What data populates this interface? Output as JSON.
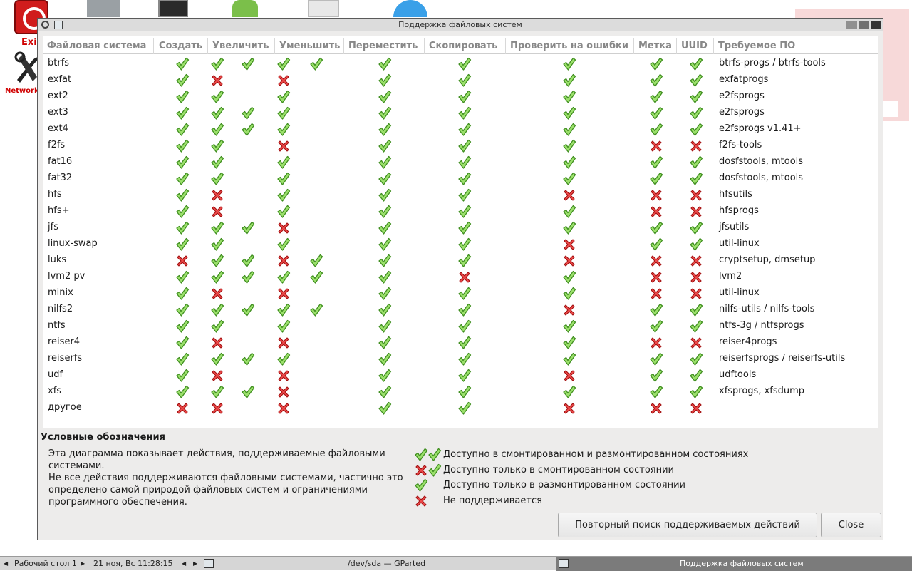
{
  "desktop": {
    "exit_label": "Exi",
    "network_label": "Network"
  },
  "window": {
    "title": "Поддержка файловых систем"
  },
  "table": {
    "headers": [
      "Файловая система",
      "Создать",
      "Увеличить",
      "Уменьшить",
      "Переместить",
      "Скопировать",
      "Проверить на ошибки",
      "Метка",
      "UUID",
      "Требуемое ПО"
    ],
    "rows": [
      {
        "fs": "btrfs",
        "software": "btrfs-progs / btrfs-tools",
        "create": "y",
        "grow": "yy",
        "shrink": "yy",
        "move": "y",
        "copy": "y",
        "check": "y",
        "label": "y",
        "uuid": "y"
      },
      {
        "fs": "exfat",
        "software": "exfatprogs",
        "create": "y",
        "grow": "n",
        "shrink": "n",
        "move": "y",
        "copy": "y",
        "check": "y",
        "label": "y",
        "uuid": "y"
      },
      {
        "fs": "ext2",
        "software": "e2fsprogs",
        "create": "y",
        "grow": "y",
        "shrink": "y",
        "move": "y",
        "copy": "y",
        "check": "y",
        "label": "y",
        "uuid": "y"
      },
      {
        "fs": "ext3",
        "software": "e2fsprogs",
        "create": "y",
        "grow": "yy",
        "shrink": "y",
        "move": "y",
        "copy": "y",
        "check": "y",
        "label": "y",
        "uuid": "y"
      },
      {
        "fs": "ext4",
        "software": "e2fsprogs v1.41+",
        "create": "y",
        "grow": "yy",
        "shrink": "y",
        "move": "y",
        "copy": "y",
        "check": "y",
        "label": "y",
        "uuid": "y"
      },
      {
        "fs": "f2fs",
        "software": "f2fs-tools",
        "create": "y",
        "grow": "y",
        "shrink": "n",
        "move": "y",
        "copy": "y",
        "check": "y",
        "label": "n",
        "uuid": "n"
      },
      {
        "fs": "fat16",
        "software": "dosfstools, mtools",
        "create": "y",
        "grow": "y",
        "shrink": "y",
        "move": "y",
        "copy": "y",
        "check": "y",
        "label": "y",
        "uuid": "y"
      },
      {
        "fs": "fat32",
        "software": "dosfstools, mtools",
        "create": "y",
        "grow": "y",
        "shrink": "y",
        "move": "y",
        "copy": "y",
        "check": "y",
        "label": "y",
        "uuid": "y"
      },
      {
        "fs": "hfs",
        "software": "hfsutils",
        "create": "y",
        "grow": "n",
        "shrink": "y",
        "move": "y",
        "copy": "y",
        "check": "n",
        "label": "n",
        "uuid": "n"
      },
      {
        "fs": "hfs+",
        "software": "hfsprogs",
        "create": "y",
        "grow": "n",
        "shrink": "y",
        "move": "y",
        "copy": "y",
        "check": "y",
        "label": "n",
        "uuid": "n"
      },
      {
        "fs": "jfs",
        "software": "jfsutils",
        "create": "y",
        "grow": "yy",
        "shrink": "n",
        "move": "y",
        "copy": "y",
        "check": "y",
        "label": "y",
        "uuid": "y"
      },
      {
        "fs": "linux-swap",
        "software": "util-linux",
        "create": "y",
        "grow": "y",
        "shrink": "y",
        "move": "y",
        "copy": "y",
        "check": "n",
        "label": "y",
        "uuid": "y"
      },
      {
        "fs": "luks",
        "software": "cryptsetup, dmsetup",
        "create": "n",
        "grow": "yy",
        "shrink": "ny",
        "move": "y",
        "copy": "y",
        "check": "n",
        "label": "n",
        "uuid": "n"
      },
      {
        "fs": "lvm2 pv",
        "software": "lvm2",
        "create": "y",
        "grow": "yy",
        "shrink": "yy",
        "move": "y",
        "copy": "n",
        "check": "y",
        "label": "n",
        "uuid": "n"
      },
      {
        "fs": "minix",
        "software": "util-linux",
        "create": "y",
        "grow": "n",
        "shrink": "n",
        "move": "y",
        "copy": "y",
        "check": "y",
        "label": "n",
        "uuid": "n"
      },
      {
        "fs": "nilfs2",
        "software": "nilfs-utils / nilfs-tools",
        "create": "y",
        "grow": "yy",
        "shrink": "yy",
        "move": "y",
        "copy": "y",
        "check": "n",
        "label": "y",
        "uuid": "y"
      },
      {
        "fs": "ntfs",
        "software": "ntfs-3g / ntfsprogs",
        "create": "y",
        "grow": "y",
        "shrink": "y",
        "move": "y",
        "copy": "y",
        "check": "y",
        "label": "y",
        "uuid": "y"
      },
      {
        "fs": "reiser4",
        "software": "reiser4progs",
        "create": "y",
        "grow": "n",
        "shrink": "n",
        "move": "y",
        "copy": "y",
        "check": "y",
        "label": "n",
        "uuid": "n"
      },
      {
        "fs": "reiserfs",
        "software": "reiserfsprogs / reiserfs-utils",
        "create": "y",
        "grow": "yy",
        "shrink": "y",
        "move": "y",
        "copy": "y",
        "check": "y",
        "label": "y",
        "uuid": "y"
      },
      {
        "fs": "udf",
        "software": "udftools",
        "create": "y",
        "grow": "n",
        "shrink": "n",
        "move": "y",
        "copy": "y",
        "check": "n",
        "label": "y",
        "uuid": "y"
      },
      {
        "fs": "xfs",
        "software": "xfsprogs, xfsdump",
        "create": "y",
        "grow": "yy",
        "shrink": "n",
        "move": "y",
        "copy": "y",
        "check": "y",
        "label": "y",
        "uuid": "y"
      },
      {
        "fs": "другое",
        "software": "",
        "create": "n",
        "grow": "n",
        "shrink": "n",
        "move": "y",
        "copy": "y",
        "check": "n",
        "label": "n",
        "uuid": "n"
      }
    ]
  },
  "legend": {
    "title": "Условные обозначения",
    "description": "Эта диаграмма показывает действия, поддерживаемые файловыми системами.\nНе все действия поддерживаются файловыми системами, частично это определено самой природой файловых систем и ограничениями программного обеспечения.",
    "items": [
      {
        "icons": "yy",
        "label": "Доступно в смонтированном и размонтированном состояниях"
      },
      {
        "icons": "ny",
        "label": "Доступно только в смонтированном состоянии"
      },
      {
        "icons": "y",
        "label": "Доступно только в размонтированном состоянии"
      },
      {
        "icons": "n",
        "label": "Не поддерживается"
      }
    ]
  },
  "buttons": {
    "rescan": "Повторный поиск поддерживаемых действий",
    "close": "Close"
  },
  "taskbar": {
    "desktop": "Рабочий стол 1",
    "datetime": "21 ноя, Вс 11:28:15",
    "app_title": "/dev/sda — GParted",
    "active_window": "Поддержка файловых систем"
  },
  "icons": {
    "check": "check-icon",
    "cross": "cross-icon"
  },
  "colors": {
    "check_fill": "#9be06b",
    "check_stroke": "#3f8e1f",
    "cross_fill": "#ef4c4c",
    "cross_stroke": "#a51414"
  }
}
